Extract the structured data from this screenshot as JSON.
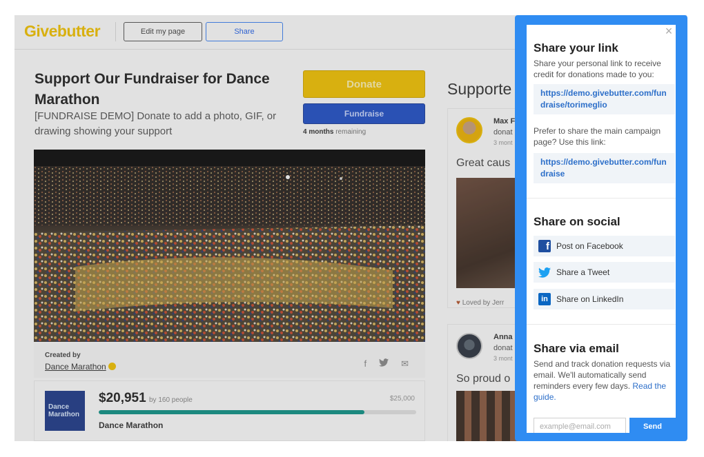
{
  "header": {
    "logo": "Givebutter",
    "edit_label": "Edit my page",
    "share_label": "Share"
  },
  "campaign": {
    "title": "Support Our Fundraiser for Dance Marathon",
    "subtitle": "[FUNDRAISE DEMO] Donate to add a photo, GIF, or drawing showing your support",
    "donate_label": "Donate",
    "fundraise_label": "Fundraise",
    "remaining_strong": "4 months",
    "remaining_rest": " remaining",
    "created_by_label": "Created by",
    "creator": "Dance Marathon",
    "raised": "$20,951",
    "raised_by": "by 160 people",
    "goal": "$25,000",
    "progress_fraction": 0.838,
    "org_logo_line1": "Dance",
    "org_logo_line2": "Marathon",
    "org_name": "Dance Marathon"
  },
  "supporters": {
    "title": "Supporte",
    "cards": [
      {
        "name": "Max F",
        "action": "donat",
        "time": "3 mont",
        "message": "Great caus",
        "loved": "Loved by Jerr"
      },
      {
        "name": "Anna",
        "action": "donat",
        "time": "3 mont",
        "message": "So proud o"
      }
    ]
  },
  "share_panel": {
    "close_symbol": "×",
    "link_title": "Share your link",
    "link_desc": "Share your personal link to receive credit for donations made to you:",
    "personal_link": "https://demo.givebutter.com/fundraise/torimeglio",
    "main_desc": "Prefer to share the main campaign page? Use this link:",
    "main_link": "https://demo.givebutter.com/fundraise",
    "social_title": "Share on social",
    "facebook_label": "Post on Facebook",
    "tweet_label": "Share a Tweet",
    "linkedin_label": "Share on LinkedIn",
    "email_title": "Share via email",
    "email_desc": "Send and track donation requests via email. We'll automatically send reminders every few days. ",
    "guide_link": "Read the guide.",
    "email_placeholder": "example@email.com",
    "send_label": "Send"
  },
  "colors": {
    "panel_border": "#2f8cf2",
    "link_text": "#2d6fc9",
    "brand_yellow": "#f5c400",
    "fundraise_blue": "#2050c8",
    "progress_teal": "#0f9488"
  }
}
